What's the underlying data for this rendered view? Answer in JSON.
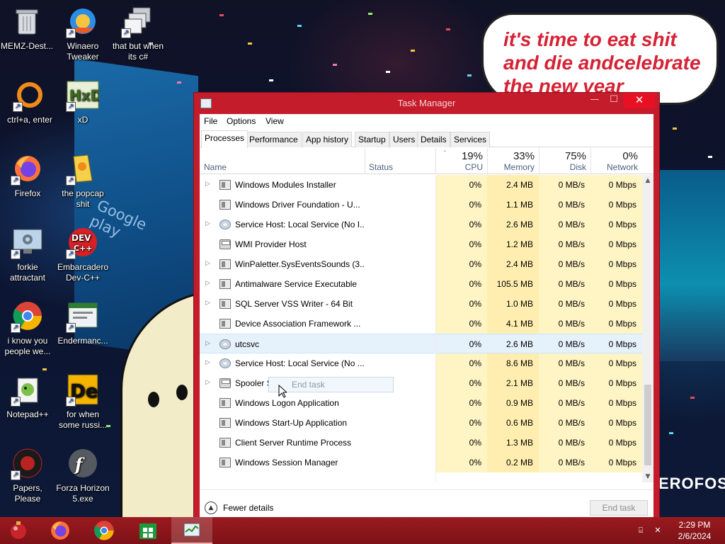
{
  "wallpaper": {
    "speech_bubble": "it's time to eat shit and die andcelebrate the new year",
    "billboard_text": "Google play",
    "side_ad_text": "EROFOS",
    "colors": {
      "speech_text": "#d62234",
      "billboard": "#1a6aa8"
    }
  },
  "desktop_icons": [
    {
      "label": "MEMZ-Dest...",
      "icon": "recycle-bin-icon"
    },
    {
      "label": "Winaero Tweaker",
      "icon": "winaero-icon"
    },
    {
      "label": "that but when its c#",
      "icon": "stacked-windows-icon"
    },
    {
      "label": "ctrl+a, enter",
      "icon": "orange-ring-icon"
    },
    {
      "label": "xD",
      "icon": "hxd-icon"
    },
    {
      "label": "Firefox",
      "icon": "firefox-icon"
    },
    {
      "label": "the popcap shit",
      "icon": "popcap-icon"
    },
    {
      "label": "forkie attractant",
      "icon": "monitor-gear-icon"
    },
    {
      "label": "Embarcadero Dev-C++",
      "icon": "devcpp-icon"
    },
    {
      "label": "i know you people we...",
      "icon": "chrome-icon"
    },
    {
      "label": "Endermanc...",
      "icon": "window-app-icon"
    },
    {
      "label": "Notepad++",
      "icon": "notepad-plus-icon"
    },
    {
      "label": "for when some russi...",
      "icon": "de-icon"
    },
    {
      "label": "Papers, Please",
      "icon": "papers-please-icon"
    },
    {
      "label": "Forza Horizon 5.exe",
      "icon": "flash-icon"
    }
  ],
  "task_manager": {
    "title": "Task Manager",
    "controls": {
      "minimize": "—",
      "maximize": "☐",
      "close": "✕"
    },
    "menu": [
      "File",
      "Options",
      "View"
    ],
    "tabs": [
      "Processes",
      "Performance",
      "App history",
      "Startup",
      "Users",
      "Details",
      "Services"
    ],
    "active_tab": "Processes",
    "columns": {
      "name": "Name",
      "status": "Status",
      "cpu": {
        "percent": "19%",
        "label": "CPU"
      },
      "memory": {
        "percent": "33%",
        "label": "Memory"
      },
      "disk": {
        "percent": "75%",
        "label": "Disk"
      },
      "network": {
        "percent": "0%",
        "label": "Network"
      }
    },
    "rows": [
      {
        "expand": true,
        "icon": "service-icon",
        "name": "Windows Modules Installer",
        "cpu": "0%",
        "memory": "2.4 MB",
        "disk": "0 MB/s",
        "network": "0 Mbps"
      },
      {
        "expand": false,
        "icon": "service-icon",
        "name": "Windows Driver Foundation - U...",
        "cpu": "0%",
        "memory": "1.1 MB",
        "disk": "0 MB/s",
        "network": "0 Mbps"
      },
      {
        "expand": true,
        "icon": "gear",
        "name": "Service Host: Local Service (No I...",
        "cpu": "0%",
        "memory": "2.6 MB",
        "disk": "0 MB/s",
        "network": "0 Mbps"
      },
      {
        "expand": false,
        "icon": "printer",
        "name": "WMI Provider Host",
        "cpu": "0%",
        "memory": "1.2 MB",
        "disk": "0 MB/s",
        "network": "0 Mbps"
      },
      {
        "expand": true,
        "icon": "service-icon",
        "name": "WinPaletter.SysEventsSounds (3...",
        "cpu": "0%",
        "memory": "2.4 MB",
        "disk": "0 MB/s",
        "network": "0 Mbps"
      },
      {
        "expand": true,
        "icon": "service-icon",
        "name": "Antimalware Service Executable",
        "cpu": "0%",
        "memory": "105.5 MB",
        "disk": "0 MB/s",
        "network": "0 Mbps"
      },
      {
        "expand": true,
        "icon": "service-icon",
        "name": "SQL Server VSS Writer - 64 Bit",
        "cpu": "0%",
        "memory": "1.0 MB",
        "disk": "0 MB/s",
        "network": "0 Mbps"
      },
      {
        "expand": false,
        "icon": "service-icon",
        "name": "Device Association Framework ...",
        "cpu": "0%",
        "memory": "4.1 MB",
        "disk": "0 MB/s",
        "network": "0 Mbps"
      },
      {
        "expand": true,
        "icon": "gear",
        "name": "utcsvc",
        "cpu": "0%",
        "memory": "2.6 MB",
        "disk": "0 MB/s",
        "network": "0 Mbps",
        "selected": true
      },
      {
        "expand": true,
        "icon": "gear",
        "name": "Service Host: Local Service (No ...",
        "cpu": "0%",
        "memory": "8.6 MB",
        "disk": "0 MB/s",
        "network": "0 Mbps"
      },
      {
        "expand": true,
        "icon": "printer",
        "name": "Spooler SubSystem App",
        "cpu": "0%",
        "memory": "2.1 MB",
        "disk": "0 MB/s",
        "network": "0 Mbps"
      },
      {
        "expand": false,
        "icon": "service-icon",
        "name": "Windows Logon Application",
        "cpu": "0%",
        "memory": "0.9 MB",
        "disk": "0 MB/s",
        "network": "0 Mbps"
      },
      {
        "expand": false,
        "icon": "service-icon",
        "name": "Windows Start-Up Application",
        "cpu": "0%",
        "memory": "0.6 MB",
        "disk": "0 MB/s",
        "network": "0 Mbps"
      },
      {
        "expand": false,
        "icon": "service-icon",
        "name": "Client Server Runtime Process",
        "cpu": "0%",
        "memory": "1.3 MB",
        "disk": "0 MB/s",
        "network": "0 Mbps"
      },
      {
        "expand": false,
        "icon": "service-icon",
        "name": "Windows Session Manager",
        "cpu": "0%",
        "memory": "0.2 MB",
        "disk": "0 MB/s",
        "network": "0 Mbps"
      }
    ],
    "context_item": "End task",
    "footer": {
      "fewer_details": "Fewer details",
      "end_task": "End task"
    },
    "colors": {
      "frame": "#c41c2a",
      "close": "#e81123",
      "cell_heat": "#fff4c4",
      "selected_row": "#e5f1fb"
    }
  },
  "taskbar": {
    "pinned": [
      "start-ornament-icon",
      "firefox-icon",
      "chrome-icon",
      "store-icon",
      "task-manager-icon"
    ],
    "clock": {
      "time": "2:29 PM",
      "date": "2/6/2024"
    },
    "colors": {
      "bar": "#9a1a1f"
    }
  }
}
